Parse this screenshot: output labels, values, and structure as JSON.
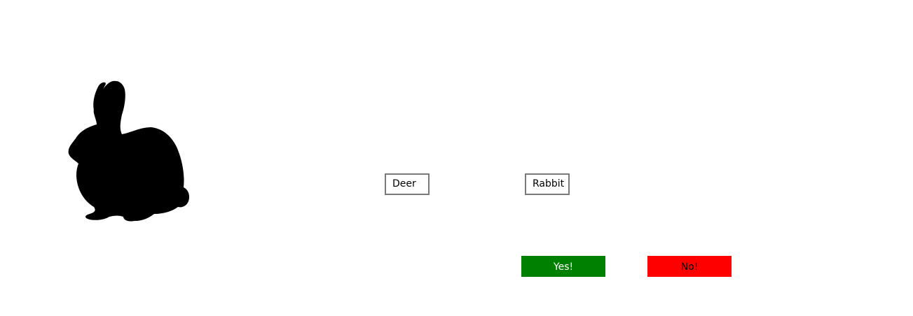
{
  "silhouette": {
    "icon": "rabbit-silhouette-icon",
    "color": "#000000"
  },
  "choices": [
    {
      "label": "Deer"
    },
    {
      "label": "Rabbit"
    }
  ],
  "answers": {
    "yes": {
      "label": "Yes!",
      "background": "#008000",
      "text_color": "#ffffff"
    },
    "no": {
      "label": "No!",
      "background": "#ff0000",
      "text_color": "#000000"
    }
  }
}
